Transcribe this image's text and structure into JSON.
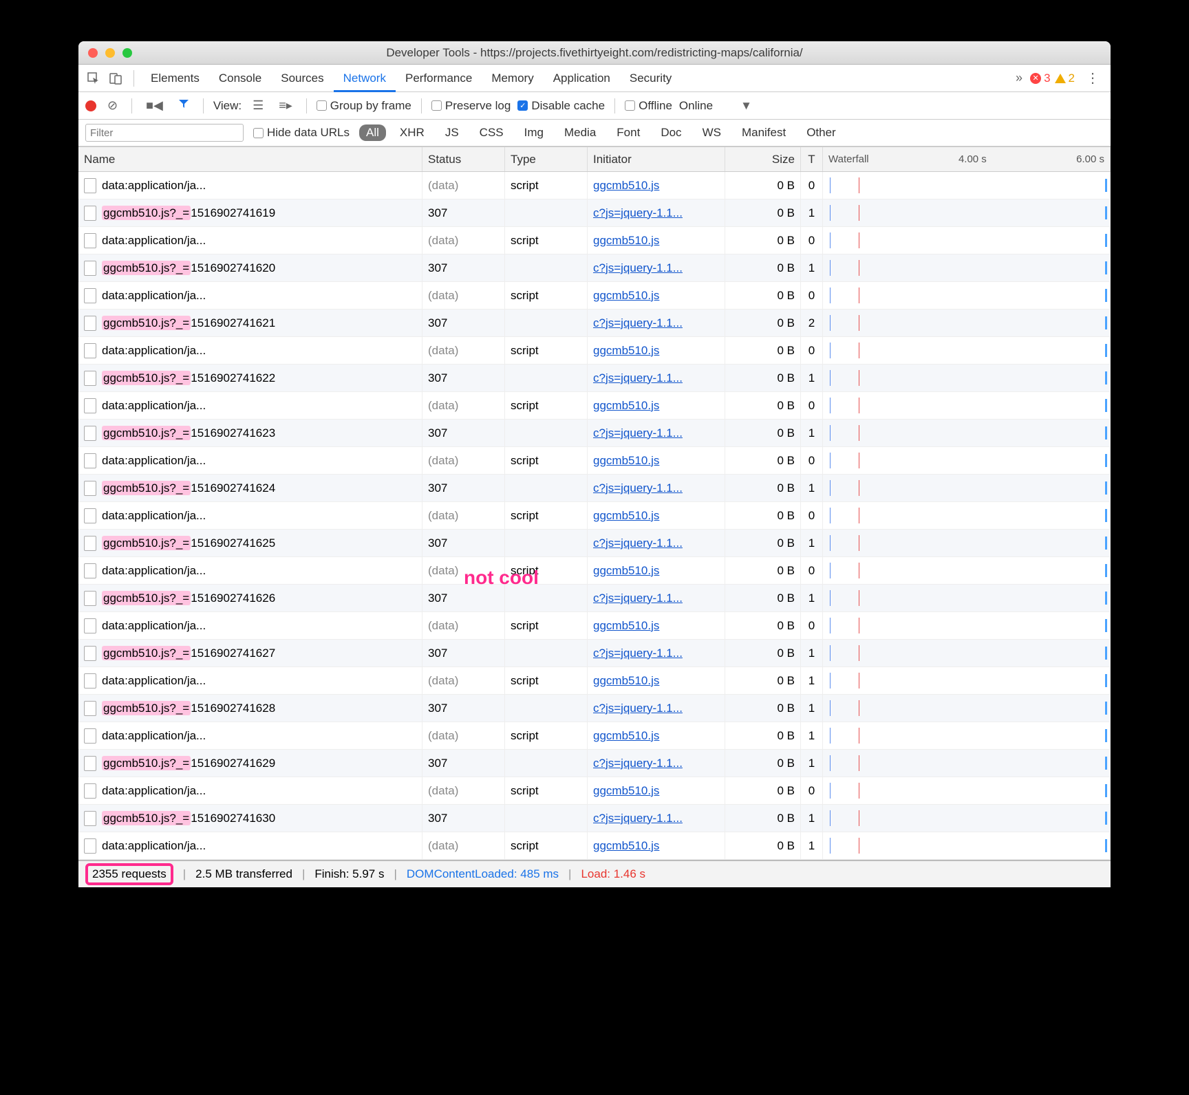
{
  "window": {
    "title": "Developer Tools - https://projects.fivethirtyeight.com/redistricting-maps/california/"
  },
  "tabs": {
    "items": [
      "Elements",
      "Console",
      "Sources",
      "Network",
      "Performance",
      "Memory",
      "Application",
      "Security"
    ],
    "active": "Network",
    "errors": "3",
    "warnings": "2"
  },
  "toolbar": {
    "view": "View:",
    "group_by_frame": "Group by frame",
    "preserve_log": "Preserve log",
    "disable_cache": "Disable cache",
    "offline": "Offline",
    "online": "Online"
  },
  "filter": {
    "placeholder": "Filter",
    "hide_data_urls": "Hide data URLs",
    "types": [
      "All",
      "XHR",
      "JS",
      "CSS",
      "Img",
      "Media",
      "Font",
      "Doc",
      "WS",
      "Manifest",
      "Other"
    ],
    "active": "All"
  },
  "table": {
    "headers": {
      "name": "Name",
      "status": "Status",
      "type": "Type",
      "initiator": "Initiator",
      "size": "Size",
      "t": "T",
      "waterfall": "Waterfall",
      "wf_mid": "4.00 s",
      "wf_end": "6.00 s"
    },
    "rows": [
      {
        "name": "data:application/ja...",
        "status": "(data)",
        "type": "script",
        "initiator": "ggcmb510.js",
        "size": "0 B",
        "t": "0",
        "hl": false,
        "grey": true
      },
      {
        "name": "ggcmb510.js?_=1516902741619",
        "status": "307",
        "type": "",
        "initiator": "c?js=jquery-1.1...",
        "size": "0 B",
        "t": "1",
        "hl": true,
        "grey": false
      },
      {
        "name": "data:application/ja...",
        "status": "(data)",
        "type": "script",
        "initiator": "ggcmb510.js",
        "size": "0 B",
        "t": "0",
        "hl": false,
        "grey": true
      },
      {
        "name": "ggcmb510.js?_=1516902741620",
        "status": "307",
        "type": "",
        "initiator": "c?js=jquery-1.1...",
        "size": "0 B",
        "t": "1",
        "hl": true,
        "grey": false
      },
      {
        "name": "data:application/ja...",
        "status": "(data)",
        "type": "script",
        "initiator": "ggcmb510.js",
        "size": "0 B",
        "t": "0",
        "hl": false,
        "grey": true
      },
      {
        "name": "ggcmb510.js?_=1516902741621",
        "status": "307",
        "type": "",
        "initiator": "c?js=jquery-1.1...",
        "size": "0 B",
        "t": "2",
        "hl": true,
        "grey": false
      },
      {
        "name": "data:application/ja...",
        "status": "(data)",
        "type": "script",
        "initiator": "ggcmb510.js",
        "size": "0 B",
        "t": "0",
        "hl": false,
        "grey": true
      },
      {
        "name": "ggcmb510.js?_=1516902741622",
        "status": "307",
        "type": "",
        "initiator": "c?js=jquery-1.1...",
        "size": "0 B",
        "t": "1",
        "hl": true,
        "grey": false
      },
      {
        "name": "data:application/ja...",
        "status": "(data)",
        "type": "script",
        "initiator": "ggcmb510.js",
        "size": "0 B",
        "t": "0",
        "hl": false,
        "grey": true
      },
      {
        "name": "ggcmb510.js?_=1516902741623",
        "status": "307",
        "type": "",
        "initiator": "c?js=jquery-1.1...",
        "size": "0 B",
        "t": "1",
        "hl": true,
        "grey": false
      },
      {
        "name": "data:application/ja...",
        "status": "(data)",
        "type": "script",
        "initiator": "ggcmb510.js",
        "size": "0 B",
        "t": "0",
        "hl": false,
        "grey": true
      },
      {
        "name": "ggcmb510.js?_=1516902741624",
        "status": "307",
        "type": "",
        "initiator": "c?js=jquery-1.1...",
        "size": "0 B",
        "t": "1",
        "hl": true,
        "grey": false
      },
      {
        "name": "data:application/ja...",
        "status": "(data)",
        "type": "script",
        "initiator": "ggcmb510.js",
        "size": "0 B",
        "t": "0",
        "hl": false,
        "grey": true
      },
      {
        "name": "ggcmb510.js?_=1516902741625",
        "status": "307",
        "type": "",
        "initiator": "c?js=jquery-1.1...",
        "size": "0 B",
        "t": "1",
        "hl": true,
        "grey": false
      },
      {
        "name": "data:application/ja...",
        "status": "(data)",
        "type": "script",
        "initiator": "ggcmb510.js",
        "size": "0 B",
        "t": "0",
        "hl": false,
        "grey": true
      },
      {
        "name": "ggcmb510.js?_=1516902741626",
        "status": "307",
        "type": "",
        "initiator": "c?js=jquery-1.1...",
        "size": "0 B",
        "t": "1",
        "hl": true,
        "grey": false
      },
      {
        "name": "data:application/ja...",
        "status": "(data)",
        "type": "script",
        "initiator": "ggcmb510.js",
        "size": "0 B",
        "t": "0",
        "hl": false,
        "grey": true
      },
      {
        "name": "ggcmb510.js?_=1516902741627",
        "status": "307",
        "type": "",
        "initiator": "c?js=jquery-1.1...",
        "size": "0 B",
        "t": "1",
        "hl": true,
        "grey": false
      },
      {
        "name": "data:application/ja...",
        "status": "(data)",
        "type": "script",
        "initiator": "ggcmb510.js",
        "size": "0 B",
        "t": "1",
        "hl": false,
        "grey": true
      },
      {
        "name": "ggcmb510.js?_=1516902741628",
        "status": "307",
        "type": "",
        "initiator": "c?js=jquery-1.1...",
        "size": "0 B",
        "t": "1",
        "hl": true,
        "grey": false
      },
      {
        "name": "data:application/ja...",
        "status": "(data)",
        "type": "script",
        "initiator": "ggcmb510.js",
        "size": "0 B",
        "t": "1",
        "hl": false,
        "grey": true
      },
      {
        "name": "ggcmb510.js?_=1516902741629",
        "status": "307",
        "type": "",
        "initiator": "c?js=jquery-1.1...",
        "size": "0 B",
        "t": "1",
        "hl": true,
        "grey": false
      },
      {
        "name": "data:application/ja...",
        "status": "(data)",
        "type": "script",
        "initiator": "ggcmb510.js",
        "size": "0 B",
        "t": "0",
        "hl": false,
        "grey": true
      },
      {
        "name": "ggcmb510.js?_=1516902741630",
        "status": "307",
        "type": "",
        "initiator": "c?js=jquery-1.1...",
        "size": "0 B",
        "t": "1",
        "hl": true,
        "grey": false
      },
      {
        "name": "data:application/ja...",
        "status": "(data)",
        "type": "script",
        "initiator": "ggcmb510.js",
        "size": "0 B",
        "t": "1",
        "hl": false,
        "grey": true
      }
    ]
  },
  "status": {
    "requests": "2355 requests",
    "transferred": "2.5 MB transferred",
    "finish": "Finish: 5.97 s",
    "dcl": "DOMContentLoaded: 485 ms",
    "load": "Load: 1.46 s"
  },
  "annotation": "not cool"
}
